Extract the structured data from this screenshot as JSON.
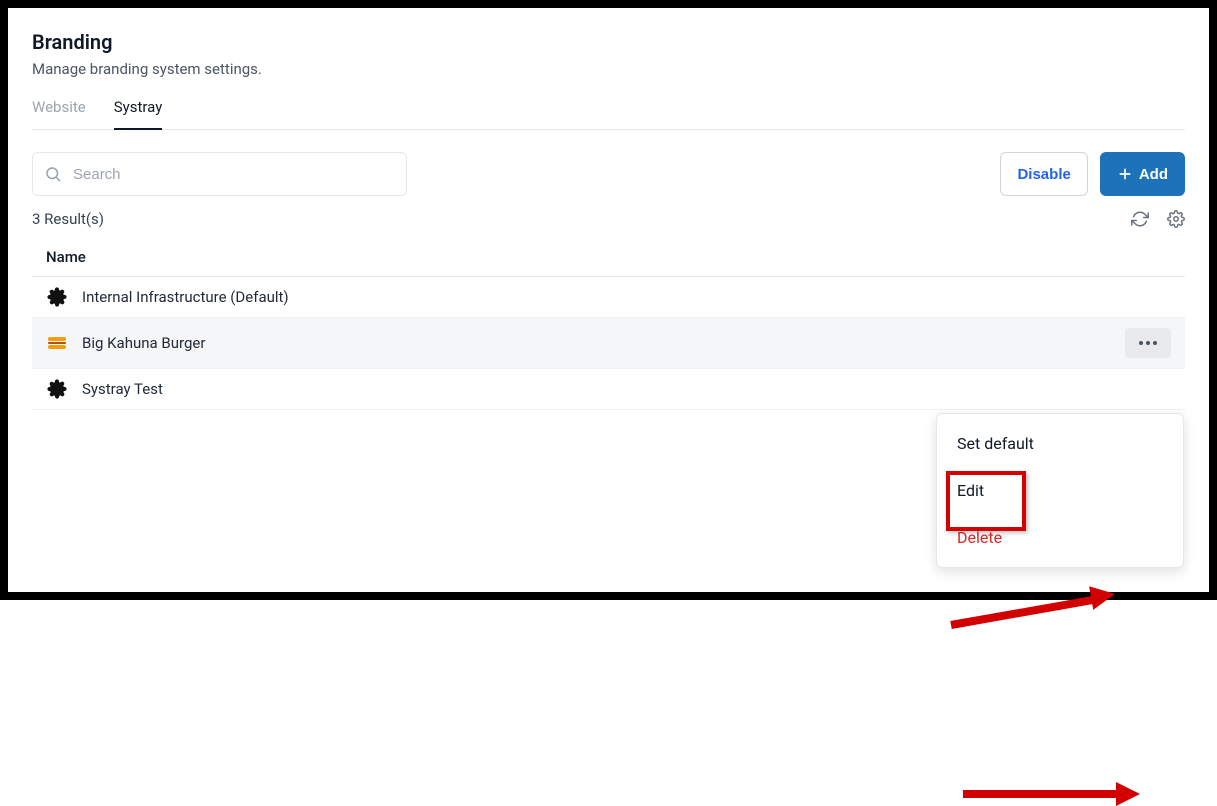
{
  "page": {
    "title": "Branding",
    "subtitle": "Manage branding system settings."
  },
  "tabs": {
    "website": "Website",
    "systray": "Systray"
  },
  "search": {
    "placeholder": "Search"
  },
  "buttons": {
    "disable": "Disable",
    "add": "Add"
  },
  "results": {
    "count_label": "3 Result(s)"
  },
  "table": {
    "header_name": "Name",
    "rows": [
      {
        "icon": "gear",
        "name": "Internal Infrastructure (Default)"
      },
      {
        "icon": "burger",
        "name": "Big Kahuna Burger"
      },
      {
        "icon": "gear",
        "name": "Systray Test"
      }
    ]
  },
  "menu": {
    "set_default": "Set default",
    "edit": "Edit",
    "delete": "Delete"
  }
}
